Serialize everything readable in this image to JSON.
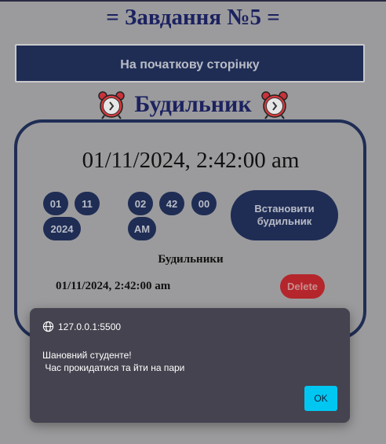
{
  "page": {
    "title": "= Завдання №5 =",
    "home_button": "На початкову сторінку"
  },
  "alarm_section": {
    "title": "Будильник",
    "icon": "alarm-clock-icon",
    "current_datetime": "01/11/2024, 2:42:00 am",
    "date_parts": {
      "day": "01",
      "month": "11",
      "year": "2024"
    },
    "time_parts": {
      "hours": "02",
      "minutes": "42",
      "seconds": "00",
      "period": "AM"
    },
    "set_button": "Встановити будильник",
    "alarms_heading": "Будильники",
    "alarms": [
      {
        "time": "01/11/2024, 2:42:00 am",
        "delete_label": "Delete"
      }
    ]
  },
  "dialog": {
    "origin": "127.0.0.1:5500",
    "message_line1": "Шановний студенте!",
    "message_line2": " Час прокидатися та йти на пари",
    "ok_label": "OK"
  },
  "colors": {
    "background": "#9b9b9d",
    "primary": "#1f2d55",
    "title": "#1c2260",
    "delete": "#b4262b",
    "dialog_bg": "#45434f",
    "ok_button": "#00c6f2"
  }
}
